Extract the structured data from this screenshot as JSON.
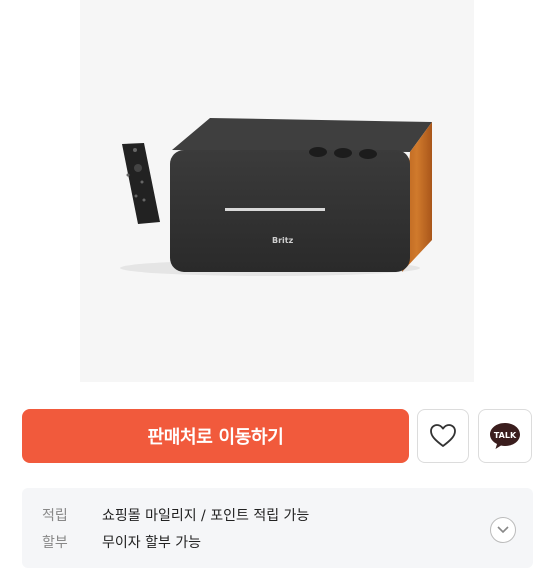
{
  "product": {
    "image_alt": "Britz speaker with remote control",
    "speaker_brand": "Britz"
  },
  "actions": {
    "go_to_seller_label": "판매처로 이동하기",
    "talk_label": "TALK"
  },
  "info": {
    "rows": [
      {
        "key": "적립",
        "value": "쇼핑몰 마일리지 / 포인트 적립 가능"
      },
      {
        "key": "할부",
        "value": "무이자 할부 가능"
      }
    ]
  },
  "colors": {
    "primary": "#f15a3c",
    "talk_bubble": "#3a1d1d"
  }
}
